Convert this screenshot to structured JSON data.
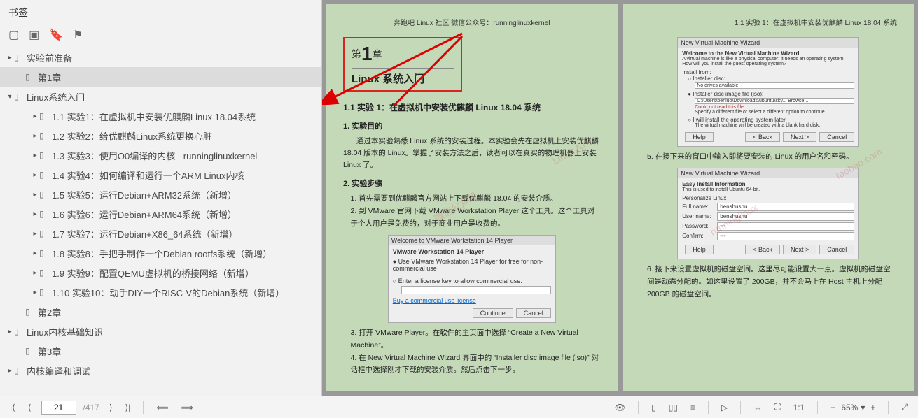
{
  "sidebar": {
    "title": "书签",
    "icons": [
      "toc-icon",
      "outline-icon",
      "bookmark-icon",
      "bookmark2-icon"
    ],
    "items": [
      {
        "level": 0,
        "caret": "▸",
        "label": "实验前准备",
        "sel": false
      },
      {
        "level": 1,
        "caret": "",
        "label": "第1章",
        "sel": true
      },
      {
        "level": 0,
        "caret": "▾",
        "label": "Linux系统入门",
        "sel": false
      },
      {
        "level": 2,
        "caret": "▸",
        "label": "1.1 实验1：在虚拟机中安装优麒麟Linux 18.04系统",
        "sel": false
      },
      {
        "level": 2,
        "caret": "▸",
        "label": "1.2 实验2：给优麒麟Linux系统更换心脏",
        "sel": false
      },
      {
        "level": 2,
        "caret": "▸",
        "label": "1.3 实验3：使用O0编译的内核 - runninglinuxkernel",
        "sel": false
      },
      {
        "level": 2,
        "caret": "▸",
        "label": "1.4 实验4：如何编译和运行一个ARM Linux内核",
        "sel": false
      },
      {
        "level": 2,
        "caret": "▸",
        "label": "1.5 实验5：运行Debian+ARM32系统（新增）",
        "sel": false
      },
      {
        "level": 2,
        "caret": "▸",
        "label": "1.6 实验6：运行Debian+ARM64系统（新增）",
        "sel": false
      },
      {
        "level": 2,
        "caret": "▸",
        "label": "1.7 实验7：运行Debian+X86_64系统（新增）",
        "sel": false
      },
      {
        "level": 2,
        "caret": "▸",
        "label": "1.8 实验8：手把手制作一个Debian rootfs系统（新增）",
        "sel": false
      },
      {
        "level": 2,
        "caret": "▸",
        "label": "1.9 实验9：配置QEMU虚拟机的桥接网络（新增）",
        "sel": false
      },
      {
        "level": 2,
        "caret": "▸",
        "label": "1.10 实验10：动手DIY一个RISC-V的Debian系统（新增）",
        "sel": false
      },
      {
        "level": 1,
        "caret": "",
        "label": "第2章",
        "sel": false
      },
      {
        "level": 0,
        "caret": "▸",
        "label": "Linux内核基础知识",
        "sel": false
      },
      {
        "level": 1,
        "caret": "",
        "label": "第3章",
        "sel": false
      },
      {
        "level": 0,
        "caret": "▸",
        "label": "内核编译和调试",
        "sel": false
      }
    ]
  },
  "page_left": {
    "header": "奔跑吧 Linux 社区  微信公众号：runninglinuxkernel",
    "chapter_prefix": "第",
    "chapter_num": "1",
    "chapter_suffix": "章",
    "chapter_name": "Linux 系统入门",
    "sec_title": "1.1  实验 1：在虚拟机中安装优麒麟 Linux 18.04 系统",
    "sub1": "1.  实验目的",
    "para1": "通过本实验熟悉 Linux 系统的安装过程。本实验会先在虚拟机上安装优麒麟 18.04 版本的 Linux。掌握了安装方法之后，读者可以在真实的物理机器上安装 Linux 了。",
    "sub2": "2.  实验步骤",
    "step1": "1.    首先需要到优麒麟官方网站上下载优麒麟 18.04 的安装介质。",
    "step2": "2.    到 VMware 官网下载 VMware Workstation Player 这个工具。这个工具对于个人用户是免费的，对于商业用户是收费的。",
    "dlg_title": "Welcome to VMware Workstation 14 Player",
    "dlg_line1": "VMware Workstation 14 Player",
    "dlg_opt1": "● Use VMware Workstation 14 Player for free for non-commercial use",
    "dlg_opt2": "○ Enter a license key to allow commercial use:",
    "dlg_link": "Buy a commercial use license",
    "dlg_btn1": "Continue",
    "dlg_btn2": "Cancel",
    "step3": "3.    打开 VMware Player。在软件的主页面中选择 “Create a New Virtual Machine”。",
    "step4": "4.    在 New Virtual Machine Wizard 界面中的 “Installer disc image file (iso)” 对话框中选择刚才下载的安装介质。然后点击下一步。"
  },
  "page_right": {
    "header": "1.1  实验 1：在虚拟机中安装优麒麟 Linux 18.04 系统",
    "dlg1_title": "New Virtual Machine Wizard",
    "dlg1_heading": "Welcome to the New Virtual Machine Wizard",
    "dlg1_sub": "A virtual machine is like a physical computer; it needs an operating system. How will you install the guest operating system?",
    "dlg1_from": "Install from:",
    "dlg1_opt0": "○ Installer disc:",
    "dlg1_sel": "No drives available",
    "dlg1_opt1": "● Installer disc image file (iso):",
    "dlg1_path": "C:\\Users\\benluo\\Downloads\\ubuntu\\sky...   Browse...",
    "dlg1_note1": "Could not read this file.",
    "dlg1_note2": "Specify a different file or select a different option to continue.",
    "dlg1_opt2": "○ I will install the operating system later.",
    "dlg1_note3": "The virtual machine will be created with a blank hard disk.",
    "dlg1_help": "Help",
    "dlg1_back": "< Back",
    "dlg1_next": "Next >",
    "dlg1_cancel": "Cancel",
    "step5": "5.    在接下来的窗口中输入即将要安装的 Linux 的用户名和密码。",
    "dlg2_title": "New Virtual Machine Wizard",
    "dlg2_heading": "Easy Install Information",
    "dlg2_sub": "This is used to install Ubuntu 64-bit.",
    "dlg2_section": "Personalize Linux",
    "dlg2_fullname_l": "Full name:",
    "dlg2_fullname_v": "benshushu",
    "dlg2_user_l": "User name:",
    "dlg2_user_v": "benshushu",
    "dlg2_pass_l": "Password:",
    "dlg2_pass_v": "•••",
    "dlg2_conf_l": "Confirm:",
    "dlg2_conf_v": "•••",
    "step6": "6.    接下来设置虚拟机的磁盘空间。这里尽可能设置大一点。虚拟机的磁盘空间是动态分配的。如这里设置了 200GB，并不会马上在 Host 主机上分配 200GB 的磁盘空间。"
  },
  "toolbar": {
    "page_current": "21",
    "page_total": "/417",
    "zoom": "65%"
  }
}
